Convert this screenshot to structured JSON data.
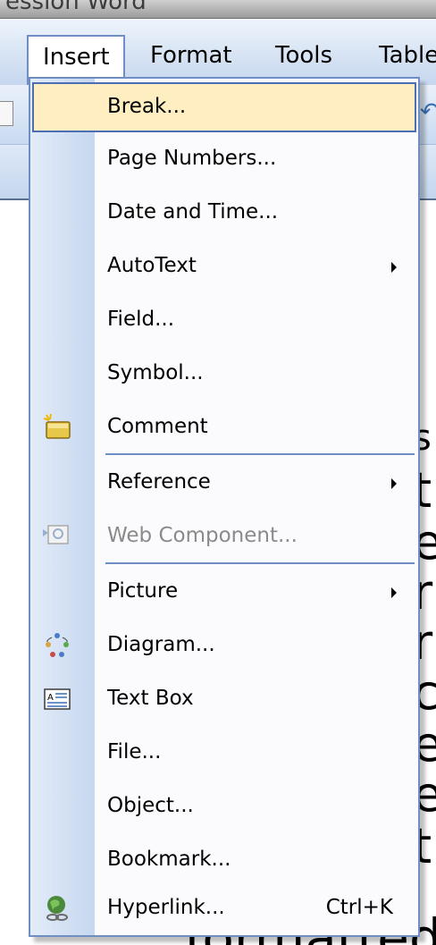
{
  "window": {
    "title_fragment": "ession Word"
  },
  "menubar": {
    "items": [
      {
        "label": "Insert",
        "active": true
      },
      {
        "label": "Format"
      },
      {
        "label": "Tools"
      },
      {
        "label": "Table"
      }
    ]
  },
  "insert_menu": {
    "items": [
      {
        "label": "Break...",
        "highlighted": true
      },
      {
        "label": "Page Numbers..."
      },
      {
        "label": "Date and Time..."
      },
      {
        "label": "AutoText",
        "submenu": true
      },
      {
        "label": "Field..."
      },
      {
        "label": "Symbol..."
      },
      {
        "label": "Comment",
        "icon": "comment-icon"
      },
      {
        "label": "Reference",
        "submenu": true
      },
      {
        "label": "Web Component...",
        "icon": "web-component-icon",
        "disabled": true
      },
      {
        "label": "Picture",
        "submenu": true
      },
      {
        "label": "Diagram...",
        "icon": "diagram-icon"
      },
      {
        "label": "Text Box",
        "icon": "text-box-icon"
      },
      {
        "label": "File..."
      },
      {
        "label": "Object..."
      },
      {
        "label": "Bookmark..."
      },
      {
        "label": "Hyperlink...",
        "shortcut": "Ctrl+K",
        "icon": "hyperlink-icon"
      }
    ]
  },
  "document": {
    "visible_glyphs": [
      "s",
      "t",
      "e",
      "r",
      "r",
      "c",
      "e",
      "e",
      "t"
    ],
    "bottom_text": "formatted t"
  },
  "colors": {
    "highlight_bg": "#ffeec2",
    "highlight_border": "#4c6fb3",
    "menu_border": "#6f8ec4",
    "disabled_text": "#8a8a8a"
  }
}
